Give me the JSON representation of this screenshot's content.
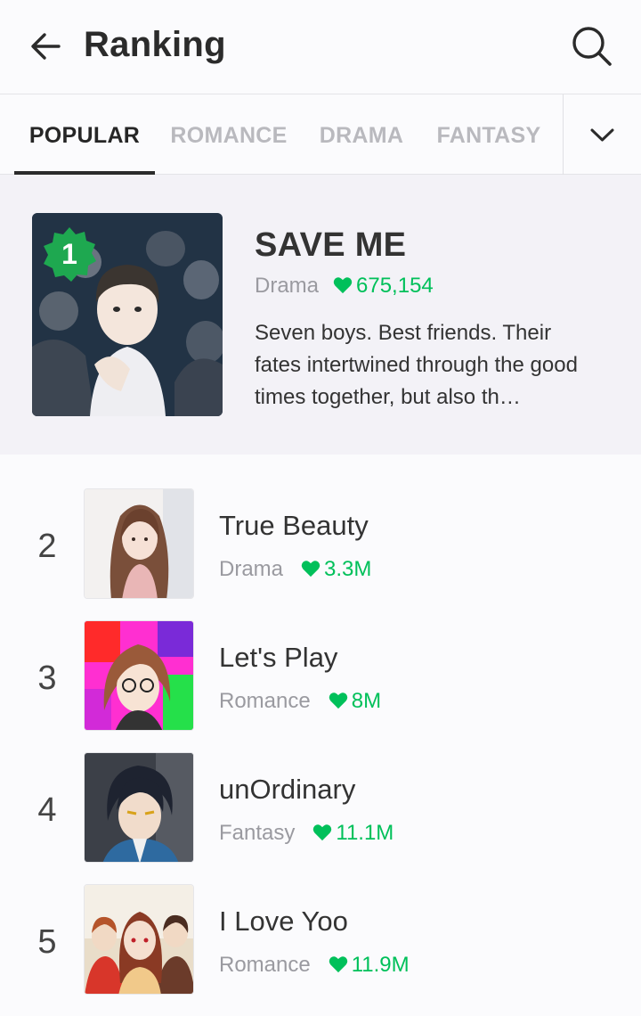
{
  "header": {
    "title": "Ranking",
    "back_icon": "arrow-left-icon",
    "search_icon": "search-icon"
  },
  "tabs": [
    {
      "label": "POPULAR",
      "active": true
    },
    {
      "label": "ROMANCE",
      "active": false
    },
    {
      "label": "DRAMA",
      "active": false
    },
    {
      "label": "FANTASY",
      "active": false
    }
  ],
  "tabs_more_icon": "chevron-down-icon",
  "featured": {
    "rank": "1",
    "title": "SAVE ME",
    "genre": "Drama",
    "likes": "675,154",
    "description": "Seven boys. Best friends. Their fates intertwined through the good times together, but also th…"
  },
  "list": [
    {
      "rank": "2",
      "title": "True Beauty",
      "genre": "Drama",
      "likes": "3.3M"
    },
    {
      "rank": "3",
      "title": "Let's Play",
      "genre": "Romance",
      "likes": "8M"
    },
    {
      "rank": "4",
      "title": "unOrdinary",
      "genre": "Fantasy",
      "likes": "11.1M"
    },
    {
      "rank": "5",
      "title": "I Love Yoo",
      "genre": "Romance",
      "likes": "11.9M"
    }
  ],
  "colors": {
    "accent_green": "#00c05a",
    "badge_green": "#1ea850",
    "muted_text": "#9a9aa0",
    "active_tab": "#262626",
    "inactive_tab": "#b9b9be"
  }
}
